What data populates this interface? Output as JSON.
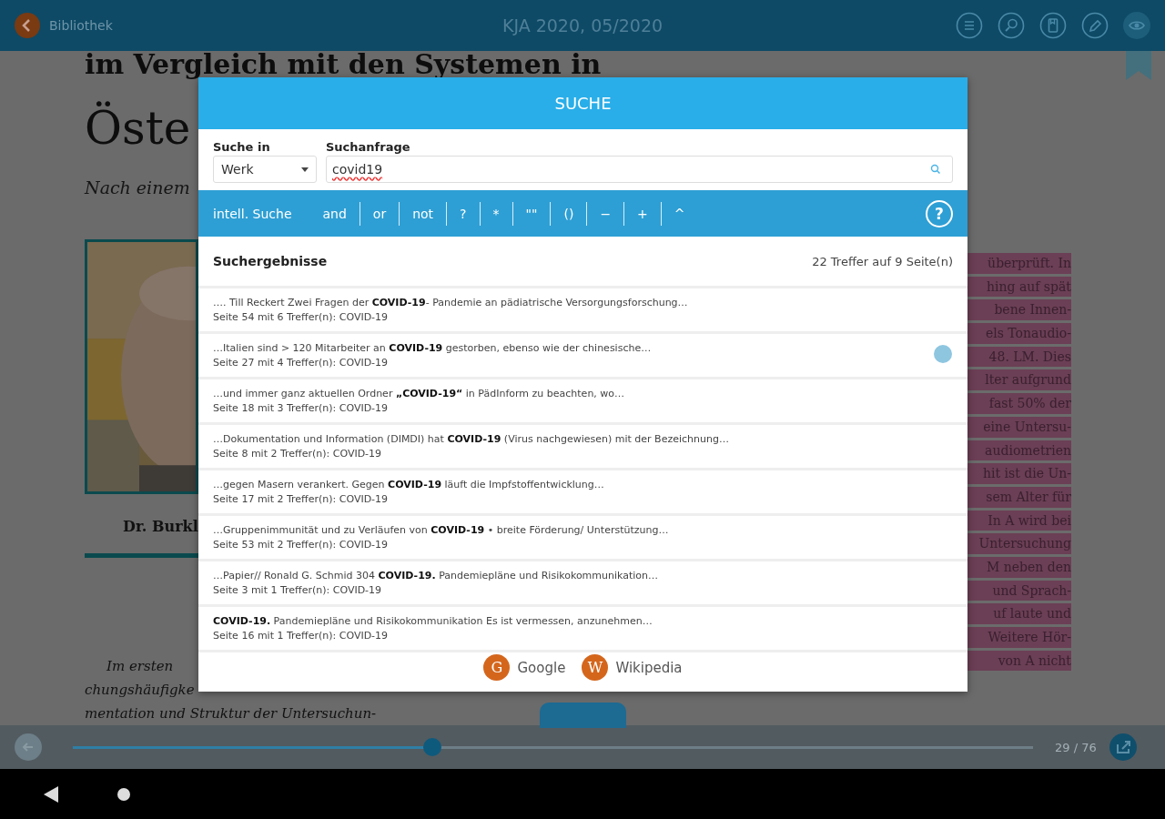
{
  "top_bar": {
    "back_label": "Bibliothek",
    "title": "KJA 2020, 05/2020"
  },
  "document": {
    "heading": [
      "im Vergleich mit den Systemen in",
      "Öste"
    ],
    "subtitle": "Nach einem",
    "caption": "Dr. Burkl",
    "paragraph": [
      "Im ersten",
      "chungshäufigke",
      "mentation und Struktur der Untersuchun-"
    ],
    "highlighted_lines": [
      "überprüft. In",
      "hing auf spät",
      "bene Innen-",
      "els Tonaudio-",
      "48. LM. Dies",
      "lter aufgrund",
      "fast 50% der",
      "eine Untersu-",
      "audiometrien",
      "hit ist die Un-",
      "sem Alter für",
      "In A wird bei",
      "Untersuchung",
      "M neben den",
      "und Sprach-",
      "uf laute und",
      "Weitere Hör-",
      "von A nicht"
    ]
  },
  "search_dialog": {
    "title": "SUCHE",
    "scope_label": "Suche in",
    "scope_value": "Werk",
    "query_label": "Suchanfrage",
    "query_value": "covid19",
    "operators": [
      {
        "label": "intell. Suche",
        "kind": "mode"
      },
      {
        "label": "and",
        "kind": "op"
      },
      {
        "label": "or",
        "kind": "op"
      },
      {
        "label": "not",
        "kind": "op"
      },
      {
        "label": "?",
        "kind": "op"
      },
      {
        "label": "*",
        "kind": "op"
      },
      {
        "label": "\"\"",
        "kind": "op"
      },
      {
        "label": "()",
        "kind": "op"
      },
      {
        "label": "−",
        "kind": "op"
      },
      {
        "label": "+",
        "kind": "op"
      },
      {
        "label": "^",
        "kind": "op"
      }
    ],
    "help": "?",
    "results_label": "Suchergebnisse",
    "results_count": "22 Treffer auf 9 Seite(n)",
    "results": [
      {
        "snippet": "…. Till Reckert Zwei Fragen der **COVID-19**- Pandemie an pädiatrische Versorgungsforschung…",
        "meta": "Seite 54 mit 6 Treffer(n): COVID-19"
      },
      {
        "snippet": "…Italien sind > 120 Mitarbeiter an **COVID-19** gestorben, ebenso wie der chinesische…",
        "meta": "Seite 27 mit 4 Treffer(n): COVID-19"
      },
      {
        "snippet": "…und immer ganz aktuellen Ordner **„COVID-19“** in PädInform zu beachten, wo…",
        "meta": "Seite 18 mit 3 Treffer(n): COVID-19"
      },
      {
        "snippet": "…Dokumentation und Information (DIMDI) hat **COVID-19** (Virus nachgewiesen) mit der Bezeichnung…",
        "meta": "Seite 8 mit 2 Treffer(n): COVID-19"
      },
      {
        "snippet": "…gegen Masern verankert. Gegen **COVID-19** läuft die Impfstoffentwicklung…",
        "meta": "Seite 17 mit 2 Treffer(n): COVID-19"
      },
      {
        "snippet": "…Gruppenimmunität und zu Verläufen von **COVID-19** • breite Förderung/ Unterstützung…",
        "meta": "Seite 53 mit 2 Treffer(n): COVID-19"
      },
      {
        "snippet": "…Papier// Ronald G. Schmid 304 **COVID-19.** Pandemiepläne und Risikokommunikation…",
        "meta": "Seite 3 mit 1 Treffer(n): COVID-19"
      },
      {
        "snippet": "**COVID-19.** Pandemiepläne und Risikokommunikation Es ist vermessen, anzunehmen…",
        "meta": "Seite 16 mit 1 Treffer(n): COVID-19"
      }
    ],
    "links": [
      {
        "letter": "G",
        "label": "Google"
      },
      {
        "letter": "W",
        "label": "Wikipedia"
      }
    ]
  },
  "bottom_bar": {
    "progress": {
      "level": 0.374
    },
    "page_count": "29 / 76"
  }
}
